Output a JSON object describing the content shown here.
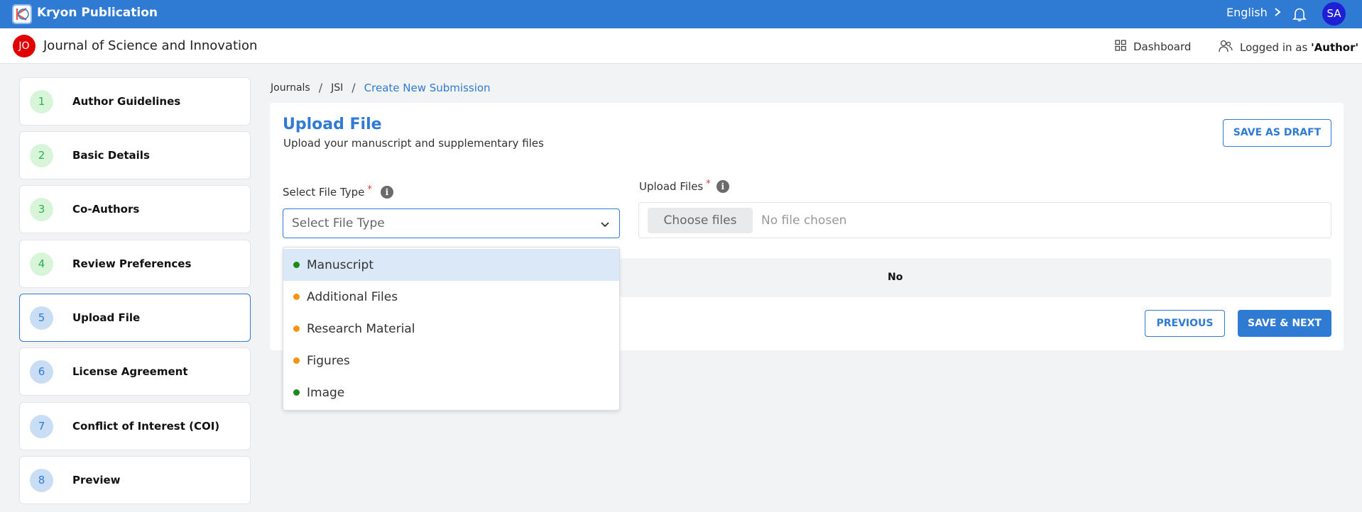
{
  "topbar": {
    "brand": "Kryon Publication",
    "language": "English",
    "avatar_initials": "SA"
  },
  "subheader": {
    "journal_initials": "JO",
    "journal_title": "Journal of Science and Innovation",
    "dashboard_label": "Dashboard",
    "logged_in_prefix": "Logged in as",
    "role": "'Author'"
  },
  "steps": [
    {
      "num": "1",
      "label": "Author Guidelines"
    },
    {
      "num": "2",
      "label": "Basic Details"
    },
    {
      "num": "3",
      "label": "Co-Authors"
    },
    {
      "num": "4",
      "label": "Review Preferences"
    },
    {
      "num": "5",
      "label": "Upload File"
    },
    {
      "num": "6",
      "label": "License Agreement"
    },
    {
      "num": "7",
      "label": "Conflict of Interest (COI)"
    },
    {
      "num": "8",
      "label": "Preview"
    }
  ],
  "breadcrumb": {
    "items": [
      "Journals",
      "JSI"
    ],
    "current": "Create New Submission"
  },
  "main": {
    "title": "Upload File",
    "subtitle": "Upload your manuscript and supplementary files",
    "save_draft_label": "SAVE AS DRAFT",
    "file_type_label": "Select File Type",
    "file_type_placeholder": "Select File Type",
    "upload_files_label": "Upload Files",
    "choose_files_label": "Choose files",
    "no_file_text": "No file chosen",
    "required_mark": "*",
    "info_glyph": "i",
    "strip_text": "No",
    "previous_label": "PREVIOUS",
    "next_label": "SAVE & NEXT"
  },
  "dropdown": {
    "options": [
      {
        "label": "Manuscript",
        "dot_color": "#1a8a1a"
      },
      {
        "label": "Additional Files",
        "dot_color": "#f59312"
      },
      {
        "label": "Research Material",
        "dot_color": "#f59312"
      },
      {
        "label": "Figures",
        "dot_color": "#f59312"
      },
      {
        "label": "Image",
        "dot_color": "#1a8a1a"
      }
    ]
  },
  "colors": {
    "primary": "#2f7bd3",
    "avatar": "#1f1fd6",
    "journal_badge": "#e00000"
  }
}
